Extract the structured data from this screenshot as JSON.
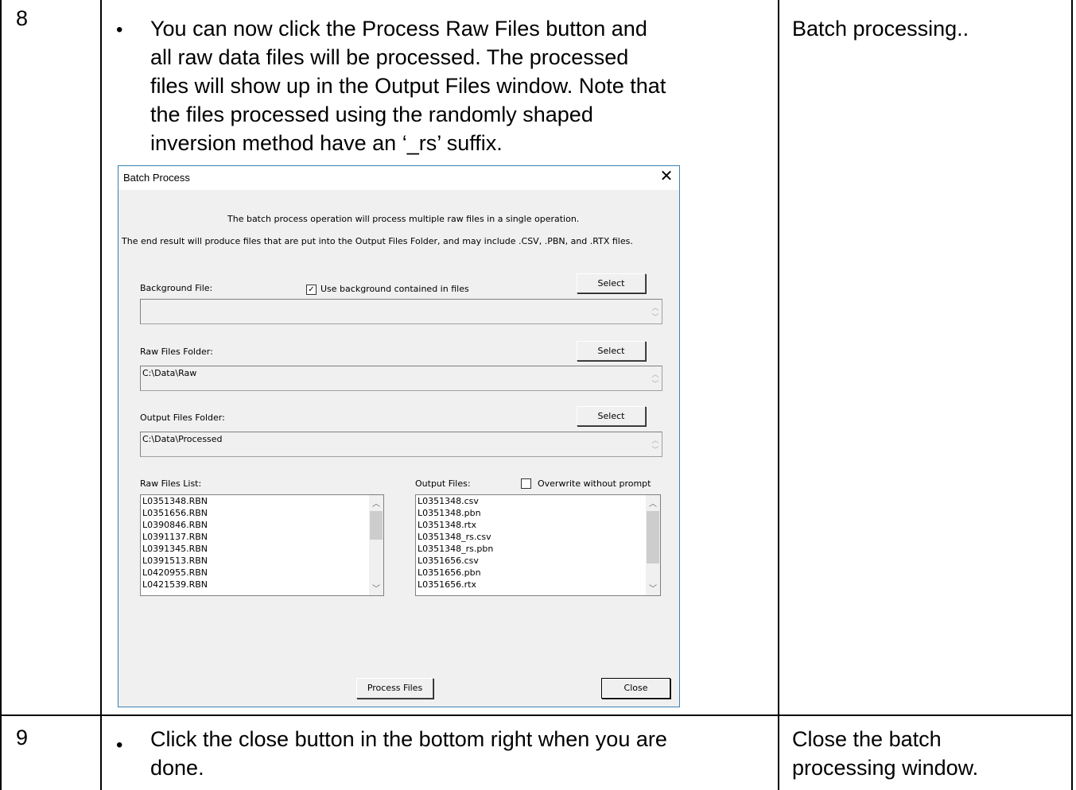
{
  "rows": [
    {
      "step": "8",
      "instruction": [
        "You can now click the Process Raw Files button and",
        "all raw data files will be processed. The processed",
        "files will show up in the Output Files window. Note that",
        "the files processed using the randomly shaped",
        "inversion method have an ‘_rs’ suffix."
      ],
      "note": "Batch processing.."
    },
    {
      "step": "9",
      "instruction": [
        "Click the close button in the bottom right when you are",
        "done."
      ],
      "note": [
        "Close the batch",
        "processing window."
      ]
    }
  ],
  "bullet": "•",
  "dialog": {
    "title": "Batch Process",
    "close_glyph": "✕",
    "intro_line1": "The batch process operation will process multiple raw files in a single operation.",
    "intro_line2": "The end result will produce files that are put into the Output Files Folder, and may include .CSV, .PBN, and .RTX files.",
    "background_label": "Background File:",
    "use_background_label": "Use background contained in files",
    "use_background_checked": true,
    "select_label": "Select",
    "background_value": "",
    "raw_folder_label": "Raw Files Folder:",
    "raw_folder_value": "C:\\Data\\Raw",
    "output_folder_label": "Output Files Folder:",
    "output_folder_value": "C:\\Data\\Processed",
    "raw_list_label": "Raw Files List:",
    "output_list_label": "Output Files:",
    "overwrite_label": "Overwrite without prompt",
    "overwrite_checked": false,
    "raw_files": [
      "L0351348.RBN",
      "L0351656.RBN",
      "L0390846.RBN",
      "L0391137.RBN",
      "L0391345.RBN",
      "L0391513.RBN",
      "L0420955.RBN",
      "L0421539.RBN"
    ],
    "output_files": [
      "L0351348.csv",
      "L0351348.pbn",
      "L0351348.rtx",
      "L0351348_rs.csv",
      "L0351348_rs.pbn",
      "L0351656.csv",
      "L0351656.pbn",
      "L0351656.rtx"
    ],
    "process_button": "Process Files",
    "close_button": "Close"
  }
}
